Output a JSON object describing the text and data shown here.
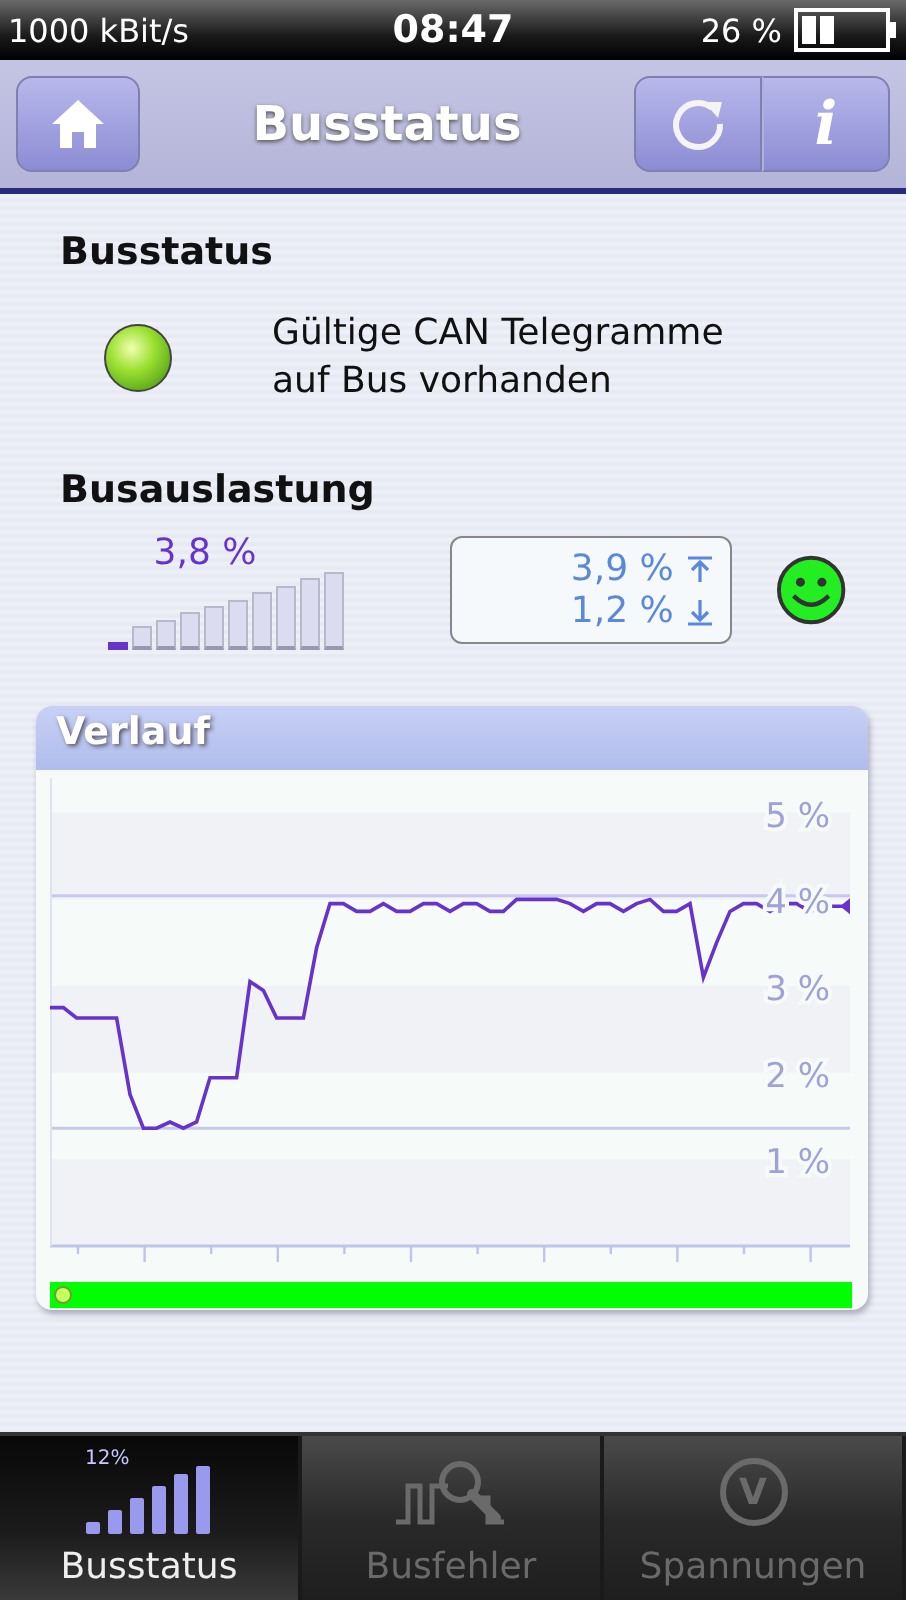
{
  "status_bar": {
    "bitrate": "1000 kBit/s",
    "time": "08:47",
    "battery": "26 %"
  },
  "header": {
    "title": "Busstatus",
    "info_symbol": "i"
  },
  "bus_status": {
    "heading": "Busstatus",
    "ok": true,
    "message": "Gültige CAN Telegramme auf Bus vorhanden"
  },
  "bus_load": {
    "heading": "Busauslastung",
    "reading": "3,8 %",
    "level": 0.038,
    "max": "3,9 %",
    "min": "1,2 %",
    "ok": true
  },
  "history": {
    "title": "Verlauf",
    "chart_data": {
      "type": "line",
      "ylim": [
        0,
        5.4
      ],
      "yticks": [
        {
          "value": 1,
          "label": "1 %"
        },
        {
          "value": 2,
          "label": "2 %"
        },
        {
          "value": 3,
          "label": "3 %"
        },
        {
          "value": 4,
          "label": "4 %"
        },
        {
          "value": 5,
          "label": "5 %"
        }
      ],
      "series": [
        {
          "color": "#6633cc",
          "values": [
            2.75,
            2.75,
            2.63,
            2.63,
            2.63,
            2.63,
            1.75,
            1.36,
            1.36,
            1.43,
            1.36,
            1.43,
            1.94,
            1.94,
            1.94,
            3.05,
            2.95,
            2.63,
            2.63,
            2.63,
            3.44,
            3.95,
            3.95,
            3.86,
            3.86,
            3.95,
            3.86,
            3.86,
            3.95,
            3.95,
            3.86,
            3.95,
            3.95,
            3.86,
            3.86,
            4.0,
            4.0,
            4.0,
            4.0,
            3.95,
            3.86,
            3.95,
            3.95,
            3.86,
            3.95,
            4.0,
            3.86,
            3.86,
            3.95,
            3.1,
            3.5,
            3.86,
            3.95,
            3.95,
            3.86,
            3.95,
            3.95,
            3.86,
            3.92,
            3.92,
            3.92
          ]
        }
      ]
    }
  },
  "tabs": [
    {
      "kind": "load",
      "label": "Busstatus",
      "badge": "12%",
      "selected": true
    },
    {
      "kind": "errors",
      "label": "Busfehler",
      "selected": false
    },
    {
      "kind": "voltage",
      "label": "Spannungen",
      "symbol": "V",
      "selected": false
    }
  ]
}
